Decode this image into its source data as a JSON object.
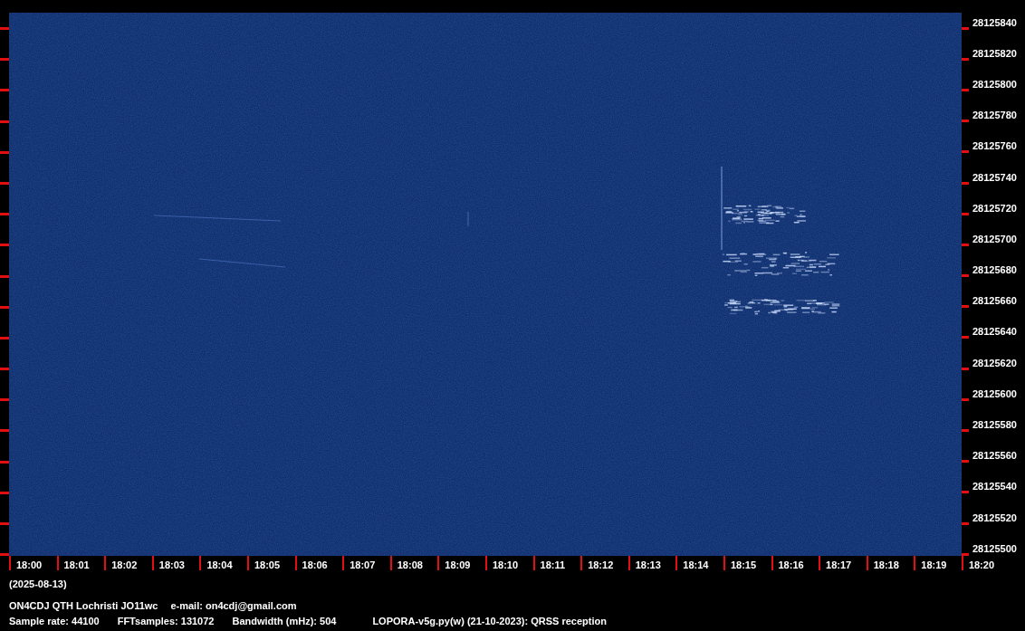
{
  "frequency_axis": {
    "labels": [
      "28125840",
      "28125820",
      "28125800",
      "28125780",
      "28125760",
      "28125740",
      "28125720",
      "28125700",
      "28125680",
      "28125660",
      "28125640",
      "28125620",
      "28125600",
      "28125580",
      "28125560",
      "28125540",
      "28125520",
      "28125500"
    ]
  },
  "time_axis": {
    "labels": [
      "18:00",
      "18:01",
      "18:02",
      "18:03",
      "18:04",
      "18:05",
      "18:06",
      "18:07",
      "18:08",
      "18:09",
      "18:10",
      "18:11",
      "18:12",
      "18:13",
      "18:14",
      "18:15",
      "18:16",
      "18:17",
      "18:18",
      "18:19",
      "18:20"
    ],
    "date": "(2025-08-13)"
  },
  "info": {
    "station": "ON4CDJ QTH Lochristi JO11wc",
    "email": "e-mail: on4cdj@gmail.com",
    "sample_rate": "Sample rate: 44100",
    "fft_samples": "FFTsamples: 131072",
    "bandwidth": "Bandwidth (mHz): 504",
    "software": "LOPORA-v5g.py(w) (21-10-2023): QRSS reception"
  }
}
